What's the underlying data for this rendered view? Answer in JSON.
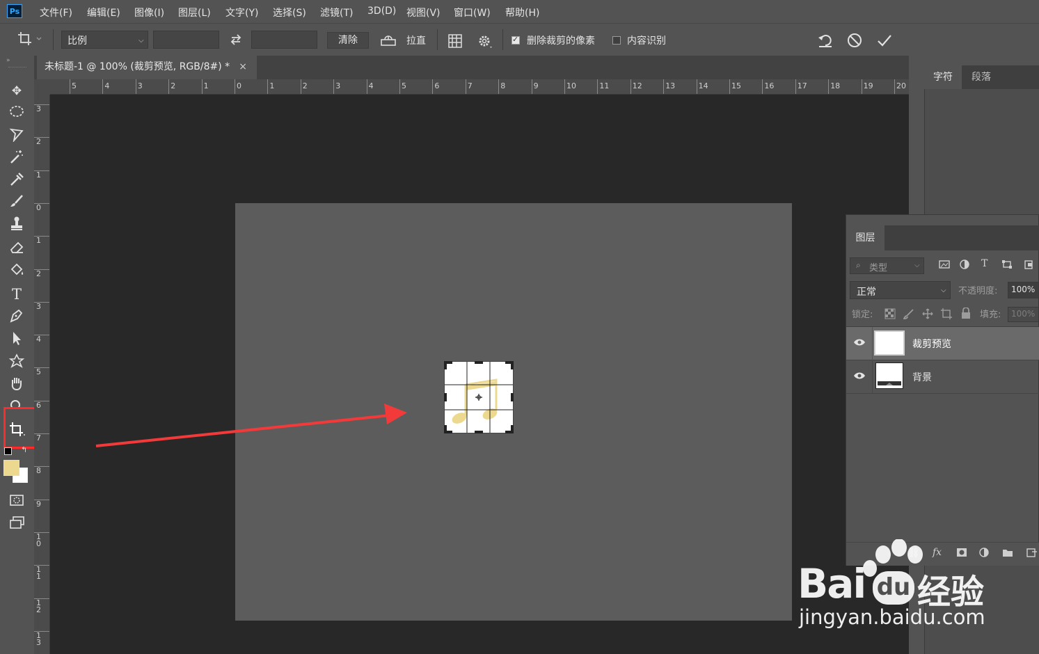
{
  "app": {
    "logo": "Ps"
  },
  "menu": [
    "文件(F)",
    "编辑(E)",
    "图像(I)",
    "图层(L)",
    "文字(Y)",
    "选择(S)",
    "滤镜(T)",
    "3D(D)",
    "视图(V)",
    "窗口(W)",
    "帮助(H)"
  ],
  "options": {
    "ratio_label": "比例",
    "clear_label": "清除",
    "straighten_label": "拉直",
    "delete_cropped_label": "删除裁剪的像素",
    "delete_cropped_checked": true,
    "content_aware_label": "内容识别",
    "content_aware_checked": false
  },
  "document": {
    "tab_title": "未标题-1 @ 100% (裁剪预览, RGB/8#) *",
    "close": "×"
  },
  "ruler_top": [
    "5",
    "4",
    "3",
    "2",
    "1",
    "0",
    "1",
    "2",
    "3",
    "4",
    "5",
    "6",
    "7",
    "8",
    "9",
    "10",
    "11",
    "12",
    "13",
    "14",
    "15",
    "16",
    "17",
    "18",
    "19",
    "20"
  ],
  "ruler_left": [
    "3",
    "2",
    "1",
    "0",
    "1",
    "2",
    "3",
    "4",
    "5",
    "6",
    "7",
    "8",
    "9",
    "1\n0",
    "1\n1",
    "1\n2",
    "1\n3"
  ],
  "panels": {
    "char_tab": "字符",
    "para_tab": "段落",
    "layers_tab": "图层",
    "filter_placeholder": "类型",
    "blend_mode": "正常",
    "opacity_label": "不透明度:",
    "opacity_value": "100%",
    "lock_label": "锁定:",
    "fill_label": "填充:",
    "fill_value": "100%",
    "layers": [
      {
        "name": "裁剪预览",
        "selected": true
      },
      {
        "name": "背景",
        "selected": false
      }
    ]
  },
  "colors": {
    "foreground": "#ecd98f",
    "background": "#ffffff",
    "highlight_box": "#ff2a2a",
    "arrow": "#f23a3a"
  },
  "watermark": {
    "brand": "Bai",
    "brand2": "du",
    "brand3": "经验",
    "url": "jingyan.baidu.com"
  }
}
